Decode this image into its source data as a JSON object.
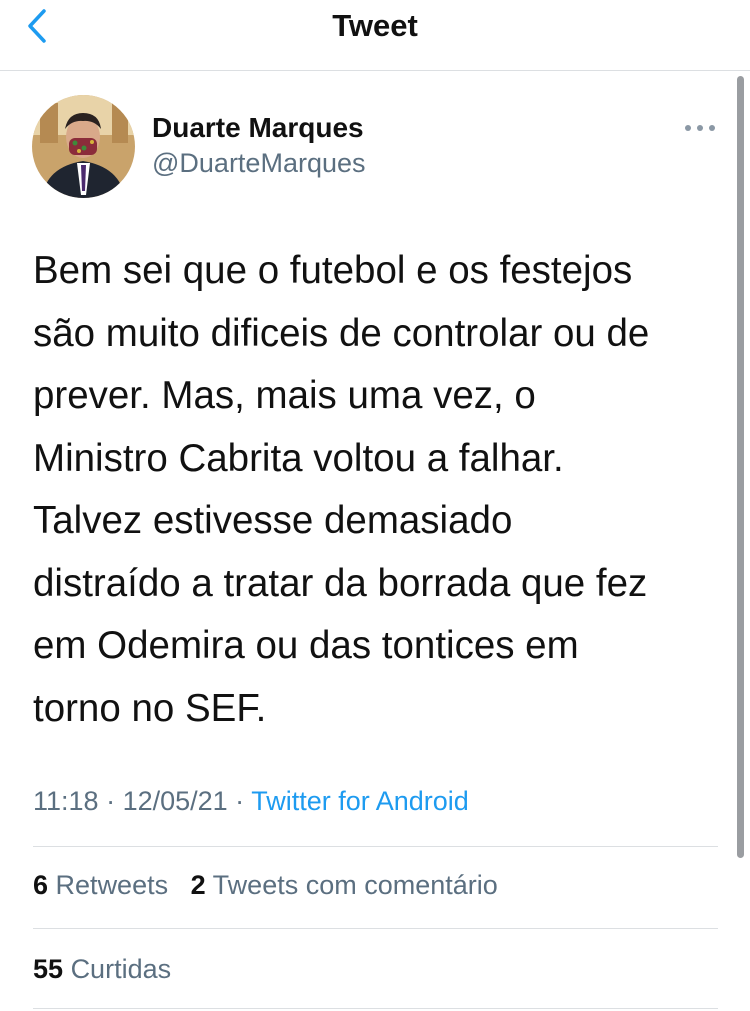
{
  "nav": {
    "title": "Tweet",
    "back_icon": "chevron-left-icon"
  },
  "tweet": {
    "author_name": "Duarte Marques",
    "author_handle": "@DuarteMarques",
    "text_lines": [
      "Bem sei que o futebol e os festejos",
      "são muito dificeis de controlar ou de",
      "prever. Mas, mais uma vez, o",
      "Ministro Cabrita voltou a falhar.",
      "Talvez estivesse demasiado",
      "distraído a tratar da borrada que fez",
      "em Odemira ou das tontices em",
      "torno no SEF."
    ],
    "time": "11:18",
    "date": "12/05/21",
    "separator": " · ",
    "source": "Twitter for Android"
  },
  "stats": {
    "retweets_count": "6",
    "retweets_label": "Retweets",
    "quotes_count": "2",
    "quotes_label": "Tweets com comentário",
    "likes_count": "55",
    "likes_label": "Curtidas"
  },
  "colors": {
    "accent": "#1d9bf0",
    "secondary_text": "#5b6f80",
    "primary_text": "#111111",
    "divider": "#dcdfe2"
  }
}
